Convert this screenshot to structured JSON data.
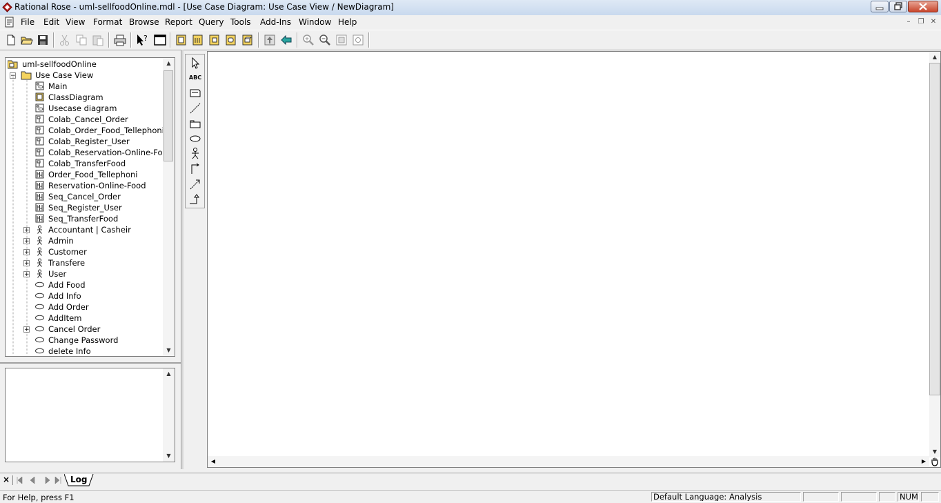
{
  "window": {
    "title": "Rational Rose - uml-sellfoodOnline.mdl - [Use Case Diagram: Use Case View / NewDiagram]"
  },
  "menu": {
    "items": [
      "File",
      "Edit",
      "View",
      "Format",
      "Browse",
      "Report",
      "Query",
      "Tools",
      "Add-Ins",
      "Window",
      "Help"
    ]
  },
  "toolbar": {
    "icons": [
      "new-icon",
      "open-icon",
      "save-icon",
      "cut-icon",
      "copy-icon",
      "paste-icon",
      "print-icon",
      "context-help-icon",
      "view-doc-icon",
      "browse-class-diagram-icon",
      "browse-interaction-diagram-icon",
      "browse-component-diagram-icon",
      "browse-deployment-diagram-icon",
      "browse-parent-icon",
      "browse-previous-icon",
      "zoom-in-icon",
      "zoom-out-icon",
      "fit-in-window-icon",
      "undo-fit-icon"
    ]
  },
  "browser": {
    "root": "uml-sellfoodOnline",
    "folder": "Use Case View",
    "items": [
      {
        "label": "Main",
        "icon": "usecase-diagram-icon",
        "expandable": false
      },
      {
        "label": "ClassDiagram",
        "icon": "class-diagram-icon",
        "expandable": false
      },
      {
        "label": "Usecase diagram",
        "icon": "usecase-diagram-icon",
        "expandable": false
      },
      {
        "label": "Colab_Cancel_Order",
        "icon": "collaboration-diagram-icon",
        "expandable": false
      },
      {
        "label": "Colab_Order_Food_Tellephoni",
        "icon": "collaboration-diagram-icon",
        "expandable": false
      },
      {
        "label": "Colab_Register_User",
        "icon": "collaboration-diagram-icon",
        "expandable": false
      },
      {
        "label": "Colab_Reservation-Online-Food",
        "icon": "collaboration-diagram-icon",
        "expandable": false
      },
      {
        "label": "Colab_TransferFood",
        "icon": "collaboration-diagram-icon",
        "expandable": false
      },
      {
        "label": "Order_Food_Tellephoni",
        "icon": "sequence-diagram-icon",
        "expandable": false
      },
      {
        "label": "Reservation-Online-Food",
        "icon": "sequence-diagram-icon",
        "expandable": false
      },
      {
        "label": "Seq_Cancel_Order",
        "icon": "sequence-diagram-icon",
        "expandable": false
      },
      {
        "label": "Seq_Register_User",
        "icon": "sequence-diagram-icon",
        "expandable": false
      },
      {
        "label": "Seq_TransferFood",
        "icon": "sequence-diagram-icon",
        "expandable": false
      },
      {
        "label": "Accountant | Casheir",
        "icon": "actor-icon",
        "expandable": true
      },
      {
        "label": "Admin",
        "icon": "actor-icon",
        "expandable": true
      },
      {
        "label": "Customer",
        "icon": "actor-icon",
        "expandable": true
      },
      {
        "label": "Transfere",
        "icon": "actor-icon",
        "expandable": true
      },
      {
        "label": "User",
        "icon": "actor-icon",
        "expandable": true
      },
      {
        "label": "Add Food",
        "icon": "usecase-icon",
        "expandable": false
      },
      {
        "label": "Add Info",
        "icon": "usecase-icon",
        "expandable": false
      },
      {
        "label": "Add Order",
        "icon": "usecase-icon",
        "expandable": false
      },
      {
        "label": "AddItem",
        "icon": "usecase-icon",
        "expandable": false
      },
      {
        "label": "Cancel Order",
        "icon": "usecase-icon",
        "expandable": true
      },
      {
        "label": "Change Password",
        "icon": "usecase-icon",
        "expandable": false
      },
      {
        "label": "delete Info",
        "icon": "usecase-icon",
        "expandable": false
      }
    ]
  },
  "toolbox": {
    "tools": [
      "selection-tool-icon",
      "text-box-tool-icon",
      "note-tool-icon",
      "anchor-note-tool-icon",
      "package-tool-icon",
      "use-case-tool-icon",
      "actor-tool-icon",
      "unidirectional-association-tool-icon",
      "dependency-tool-icon",
      "generalization-tool-icon"
    ],
    "text_tool_label": "ABC"
  },
  "log": {
    "tab_label": "Log"
  },
  "status": {
    "help_text": "For Help, press F1",
    "language": "Default Language: Analysis",
    "num": "NUM"
  },
  "colors": {
    "titlebar": "#c9d9ee",
    "folder": "#f4d35e",
    "canvas": "#ffffff"
  }
}
